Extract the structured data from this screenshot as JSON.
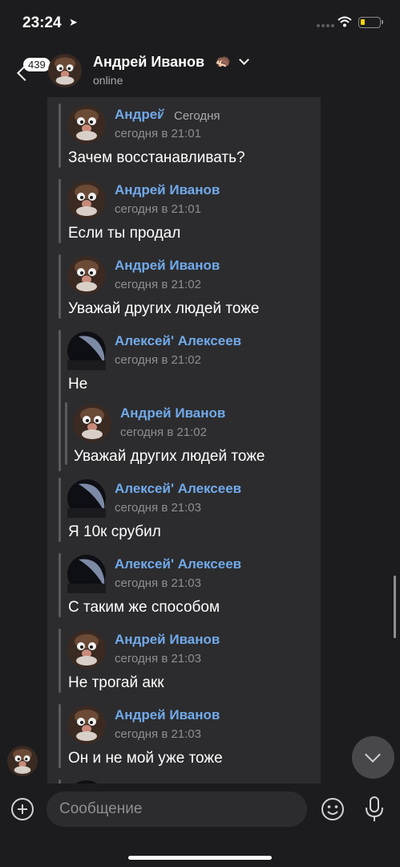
{
  "status_bar": {
    "time": "23:24"
  },
  "header": {
    "back_count": "439",
    "name": "Андрей Иванов",
    "emoji": "🦔",
    "status": "online"
  },
  "date_pill": "Сегодня",
  "messages": [
    {
      "author": "Андрей Иванов",
      "name_shown": "Андрей",
      "date": "сегодня в 21:01",
      "text": "Зачем восстанавливать?",
      "avatar": "avatar-andrey"
    },
    {
      "author": "Андрей Иванов",
      "date": "сегодня в 21:01",
      "text": "Если ты продал",
      "avatar": "avatar-andrey"
    },
    {
      "author": "Андрей Иванов",
      "date": "сегодня в 21:02",
      "text": "Уважай других людей тоже",
      "avatar": "avatar-andrey"
    },
    {
      "author": "Алексей' Алексеев",
      "date": "сегодня в 21:02",
      "text": "Не",
      "avatar": "avatar-aleksey",
      "nested": {
        "author": "Андрей Иванов",
        "date": "сегодня в 21:02",
        "text": "Уважай других людей тоже",
        "avatar": "avatar-andrey"
      }
    },
    {
      "author": "Алексей' Алексеев",
      "date": "сегодня в 21:03",
      "text": "Я 10к срубил",
      "avatar": "avatar-aleksey"
    },
    {
      "author": "Алексей' Алексеев",
      "date": "сегодня в 21:03",
      "text": "С таким же способом",
      "avatar": "avatar-aleksey"
    },
    {
      "author": "Андрей Иванов",
      "date": "сегодня в 21:03",
      "text": "Не трогай акк",
      "avatar": "avatar-andrey"
    },
    {
      "author": "Андрей Иванов",
      "date": "сегодня в 21:03",
      "text": "Он и не мой уже тоже",
      "avatar": "avatar-andrey"
    }
  ],
  "input": {
    "placeholder": "Сообщение"
  },
  "colors": {
    "accent": "#71aaeb",
    "background": "#1c1c1e",
    "panel": "#2c2c2e",
    "battery": "#ffd60a"
  }
}
